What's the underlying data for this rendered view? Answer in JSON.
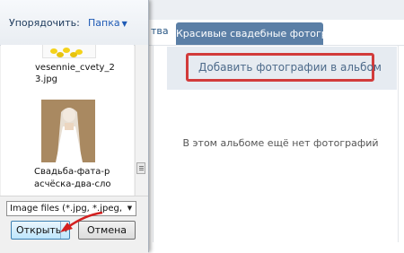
{
  "page": {
    "tab_partial": "тва",
    "tab_active": "Красивые свадебные фотогра...",
    "add_photos_label": "Добавить фотографии в альбом",
    "empty_album_text": "В этом альбоме ещё нет фотографий"
  },
  "dialog": {
    "sort_label": "Упорядочить:",
    "folder_label": "Папка",
    "files": [
      {
        "name": "vesennie_cvety_2\n3.jpg",
        "icon": "flowers-thumbnail"
      },
      {
        "name": "Свадьба-фата-р\nасчёска-два-сло",
        "icon": "bride-photo-thumbnail"
      }
    ],
    "file_type_filter": "Image files (*.jpg, *.jpeg, *.pr",
    "open_label": "Открыть",
    "cancel_label": "Отмена"
  },
  "colors": {
    "highlight": "#d23b3b",
    "tab_active_bg": "#5b7fa6",
    "link": "#1e5ab5"
  }
}
